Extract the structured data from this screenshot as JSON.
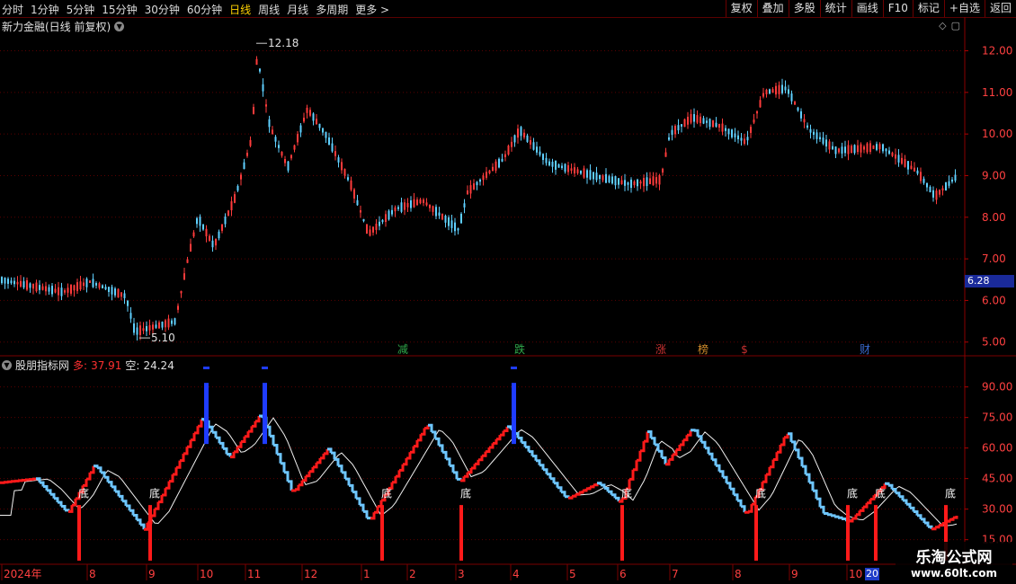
{
  "toolbar": {
    "left_items": [
      "分时",
      "1分钟",
      "5分钟",
      "15分钟",
      "30分钟",
      "60分钟",
      "日线",
      "周线",
      "月线",
      "多周期",
      "更多 >"
    ],
    "active_index": 6,
    "right_items": [
      "复权",
      "叠加",
      "多股",
      "统计",
      "画线",
      "F10",
      "标记",
      "+自选",
      "返回"
    ]
  },
  "main_chart": {
    "title": "新力金融(日线 前复权)",
    "high_label": "12.18",
    "low_label": "5.10",
    "last_price_tag": "6.28",
    "y_ticks": [
      "12.00",
      "11.00",
      "10.00",
      "9.00",
      "8.00",
      "7.00",
      "6.00",
      "5.00"
    ],
    "events": [
      {
        "label": "减",
        "color": "#2fa84a",
        "x": 448
      },
      {
        "label": "跌",
        "color": "#2fa84a",
        "x": 578
      },
      {
        "label": "涨",
        "color": "#c83030",
        "x": 735
      },
      {
        "label": "榜",
        "color": "#d08a2a",
        "x": 782
      },
      {
        "label": "$",
        "color": "#c83030",
        "x": 828
      },
      {
        "label": "财",
        "color": "#3a6ad0",
        "x": 962
      }
    ],
    "up_color": "#ff3b3b",
    "down_color": "#5fd0ff"
  },
  "indicator": {
    "name": "股朋指标网",
    "duo_label": "多:",
    "duo_value": "37.91",
    "kong_label": "空:",
    "kong_value": "24.24",
    "y_ticks": [
      "90.00",
      "75.00",
      "60.00",
      "45.00",
      "30.00",
      "15.00"
    ],
    "bottom_marker": "底",
    "signal_color": "#ff1a1a",
    "blue_color": "#1f3cff"
  },
  "x_axis": {
    "labels": [
      "2024年",
      "8",
      "9",
      "10",
      "11",
      "12",
      "1",
      "2",
      "3",
      "4",
      "5",
      "6",
      "7",
      "8",
      "9",
      "10",
      "20"
    ]
  },
  "watermark": {
    "title": "乐淘公式网",
    "url": "www.60lt.com"
  },
  "chart_data": {
    "type": "candlestick",
    "title": "新力金融(日线 前复权)",
    "ylim": [
      4.8,
      12.4
    ],
    "annotations": {
      "high": 12.18,
      "low": 5.1,
      "last": 6.28
    },
    "indicator_ylim": [
      10,
      100
    ]
  }
}
